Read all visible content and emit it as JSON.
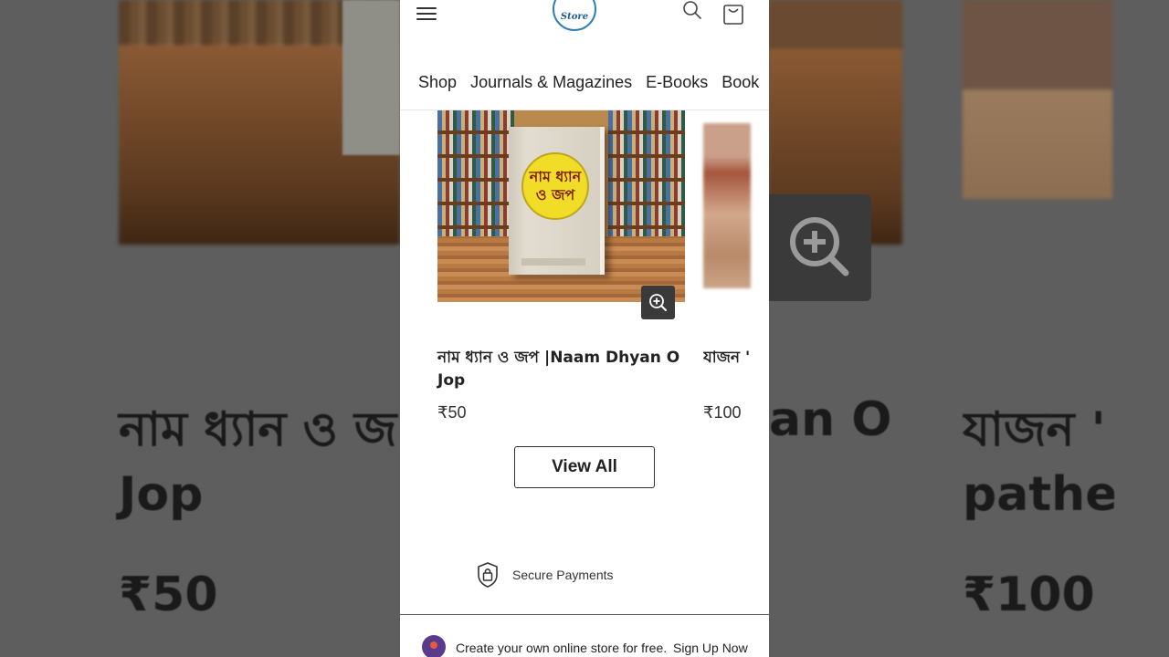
{
  "header": {
    "logo_text": "Store"
  },
  "nav": {
    "items": [
      "Shop",
      "Journals & Magazines",
      "E-Books",
      "Book"
    ]
  },
  "products": [
    {
      "title": "নাম ধ্যান ও জপ |Naam Dhyan O Jop",
      "price": "₹50",
      "cover_title": "নাম ধ্যান ও জপ"
    },
    {
      "title": "যাজন ' pathe",
      "price": "₹100"
    }
  ],
  "view_all_label": "View All",
  "secure_label": "Secure Payments",
  "footer": {
    "text": "Create your own online store for free.",
    "link": "Sign Up Now"
  },
  "background": {
    "left_title": "নাম ধ্যান ও জ",
    "left_title_line2": "Jop",
    "left_price": "₹50",
    "right_title_fragment": "an O",
    "far_right_title": "যাজন '",
    "far_right_title_line2": "pathe",
    "far_right_price": "₹100"
  },
  "colors": {
    "zoom_button_bg": "#3a3a3a",
    "logo_ring": "#2e7fb8",
    "cover_circle": "#f1dc28"
  }
}
